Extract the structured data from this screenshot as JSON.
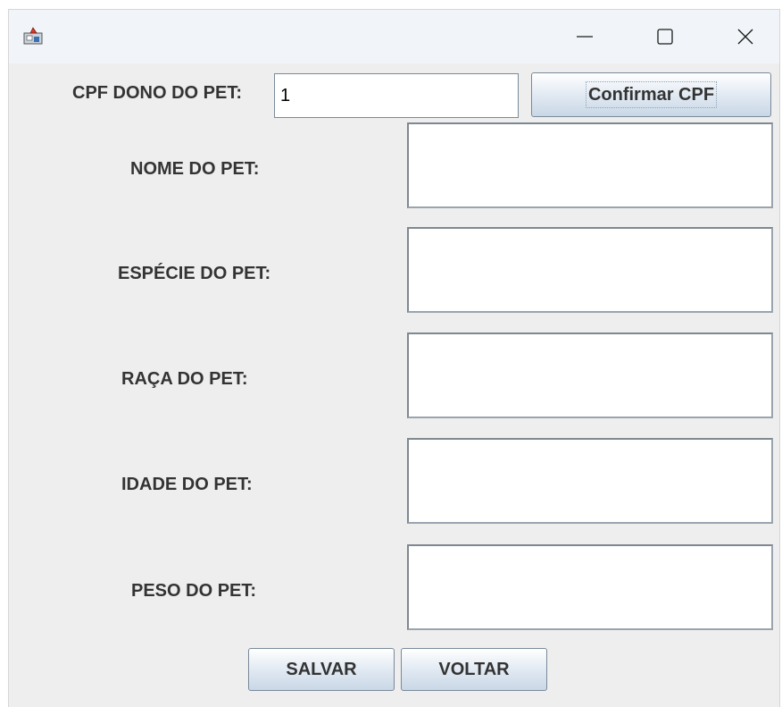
{
  "window": {
    "title": ""
  },
  "form": {
    "cpf_label": "CPF DONO DO PET:",
    "cpf_value": "1",
    "confirm_button": "Confirmar CPF",
    "nome_label": "NOME DO PET:",
    "especie_label": "ESPÉCIE DO PET:",
    "raca_label": "RAÇA DO PET:",
    "idade_label": "IDADE DO PET:",
    "peso_label": "PESO DO PET:",
    "nome_value": "",
    "especie_value": "",
    "raca_value": "",
    "idade_value": "",
    "peso_value": ""
  },
  "actions": {
    "save_label": "SALVAR",
    "back_label": "VOLTAR"
  },
  "icons": {
    "app": "java-app-icon",
    "minimize": "minimize-icon",
    "maximize": "maximize-icon",
    "close": "close-icon"
  }
}
